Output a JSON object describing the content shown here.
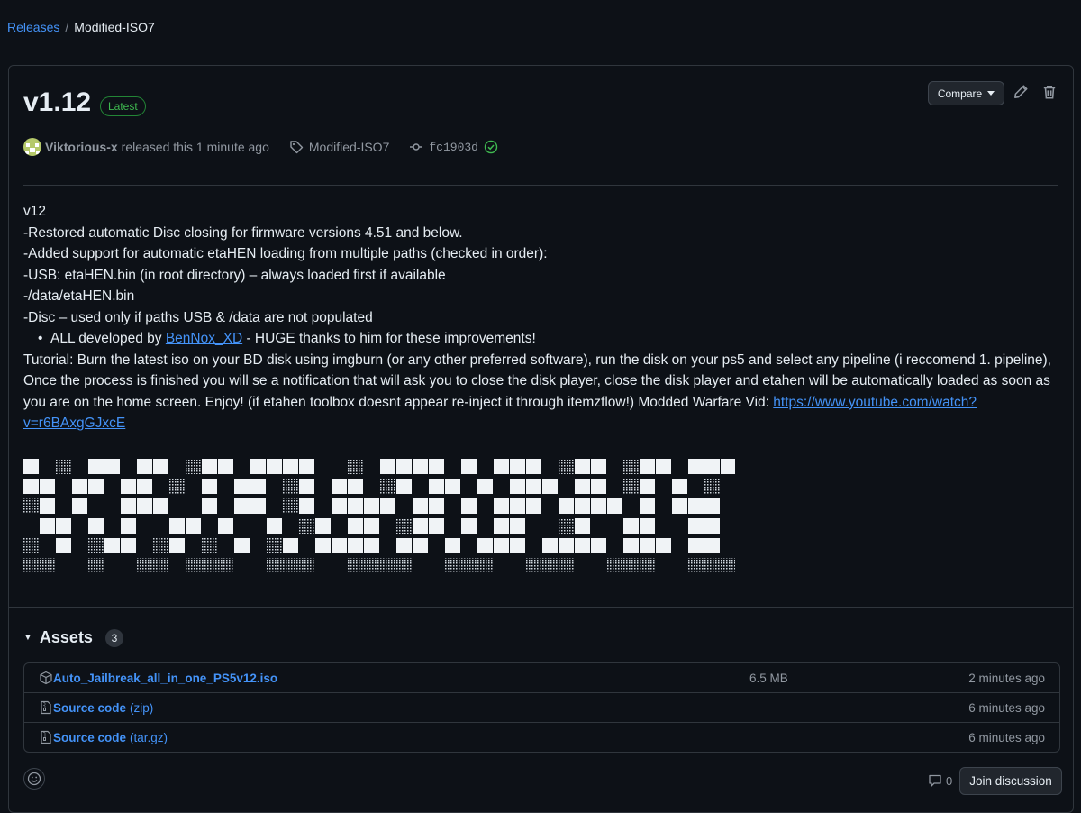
{
  "breadcrumb": {
    "root": "Releases",
    "separator": "/",
    "current": "Modified-ISO7"
  },
  "release": {
    "title": "v1.12",
    "badge": "Latest",
    "compare_label": "Compare",
    "author": "Viktorious-x",
    "released_text": "released this 1 minute ago",
    "tag": "Modified-ISO7",
    "commit": "fc1903d"
  },
  "notes": {
    "lines": [
      "v12",
      "-Restored automatic Disc closing for firmware versions 4.51 and below.",
      "-Added support for automatic etaHEN loading from multiple paths (checked in order):",
      "-USB: etaHEN.bin (in root directory) – always loaded first if available",
      "-/data/etaHEN.bin",
      "-Disc – used only if paths USB & /data are not populated"
    ],
    "bullet_prefix": "ALL developed by ",
    "bullet_link": "BenNox_XD",
    "bullet_suffix": " - HUGE thanks to him for these improvements!",
    "tutorial": "Tutorial: Burn the latest iso on your BD disk using imgburn (or any other preferred software), run the disk on your ps5 and select any pipeline (i reccomend 1. pipeline), Once the process is finished you will se a notification that will ask you to close the disk player, close the disk player and etahen will be automatically loaded as soon as you are on the home screen. Enjoy! (if etahen toolbox doesnt appear re-inject it through itemzflow!) Modded Warfare Vid: ",
    "video_link": "https://www.youtube.com/watch?v=r6BAxgGJxcE"
  },
  "assets": {
    "heading": "Assets",
    "count": "3",
    "items": [
      {
        "name": "Auto_Jailbreak_all_in_one_PS5v12.iso",
        "sub": "",
        "size": "6.5 MB",
        "time": "2 minutes ago",
        "icon": "package-icon"
      },
      {
        "name": "Source code",
        "sub": "(zip)",
        "size": "",
        "time": "6 minutes ago",
        "icon": "file-zip-icon"
      },
      {
        "name": "Source code",
        "sub": "(tar.gz)",
        "size": "",
        "time": "6 minutes ago",
        "icon": "file-zip-icon"
      }
    ]
  },
  "footer": {
    "comment_count": "0",
    "join_label": "Join discussion"
  }
}
